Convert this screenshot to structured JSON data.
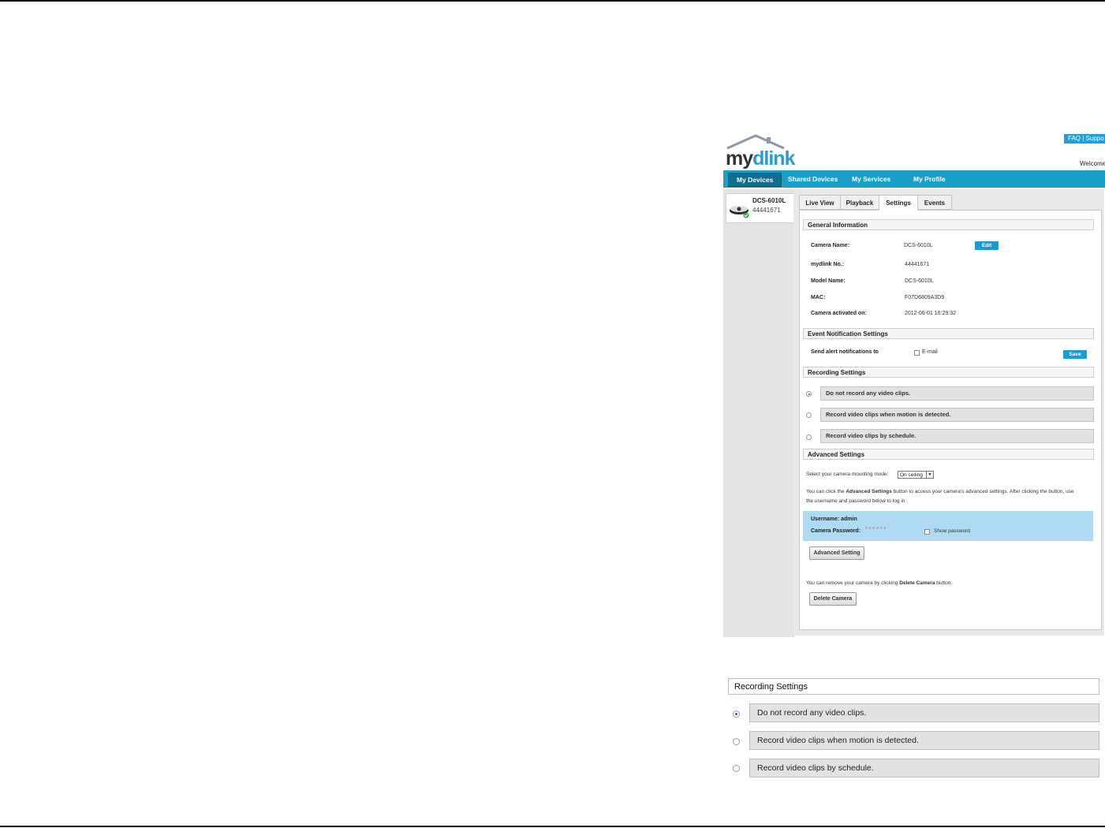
{
  "header": {
    "faq_label": "FAQ | Suppo",
    "welcome_text": "Welcome",
    "logo": {
      "my": "my",
      "dlink": "dlink"
    }
  },
  "nav": {
    "items": [
      {
        "label": "My Devices",
        "active": true
      },
      {
        "label": "Shared Devices"
      },
      {
        "label": "My Services"
      },
      {
        "label": "My Profile"
      }
    ]
  },
  "device": {
    "name": "DCS-6010L",
    "number": "44441671"
  },
  "tabs": [
    {
      "label": "Live View"
    },
    {
      "label": "Playback"
    },
    {
      "label": "Settings",
      "active": true
    },
    {
      "label": "Events"
    }
  ],
  "general": {
    "title": "General Information",
    "camera_name_label": "Camera Name:",
    "camera_name_value": "DCS-6010L",
    "edit_label": "Edit",
    "mydlink_no_label": "mydlink No.:",
    "mydlink_no_value": "44441671",
    "model_name_label": "Model Name:",
    "model_name_value": "DCS-6010L",
    "mac_label": "MAC:",
    "mac_value": "F07D6809A3D9",
    "activated_label": "Camera activated on:",
    "activated_value": "2012-06-01 16:29:32"
  },
  "event": {
    "title": "Event Notification Settings",
    "send_label": "Send alert notifications to",
    "email_label": "E-mail",
    "save_label": "Save"
  },
  "recording": {
    "title": "Recording Settings",
    "options": [
      {
        "label": "Do not record any video clips.",
        "selected": true
      },
      {
        "label": "Record video clips when motion is detected."
      },
      {
        "label": "Record video clips by schedule."
      }
    ]
  },
  "advanced": {
    "title": "Advanced Settings",
    "mount_label": "Select your camera mounting mode:",
    "mount_value": "On ceiling",
    "info_line1_pre": "You can click the ",
    "info_line1_bold": "Advanced Settings",
    "info_line1_post": " button to access your camera's advanced settings. After clicking the button, use",
    "info_line2": "the username and password below to log in.",
    "username_text": "Username: admin",
    "password_label": "Camera Password:",
    "password_mask": "* * * * * *",
    "show_password_label": "Show password",
    "advanced_button": "Advanced Setting",
    "remove_pre": "You can remove your camera by clicking ",
    "remove_bold": "Delete Camera",
    "remove_post": " button.",
    "delete_button": "Delete Camera"
  },
  "zoom": {
    "title": "Recording Settings",
    "options": [
      {
        "label": "Do not record any video clips.",
        "selected": true
      },
      {
        "label": "Record video clips when motion is detected."
      },
      {
        "label": "Record video clips by schedule."
      }
    ]
  }
}
